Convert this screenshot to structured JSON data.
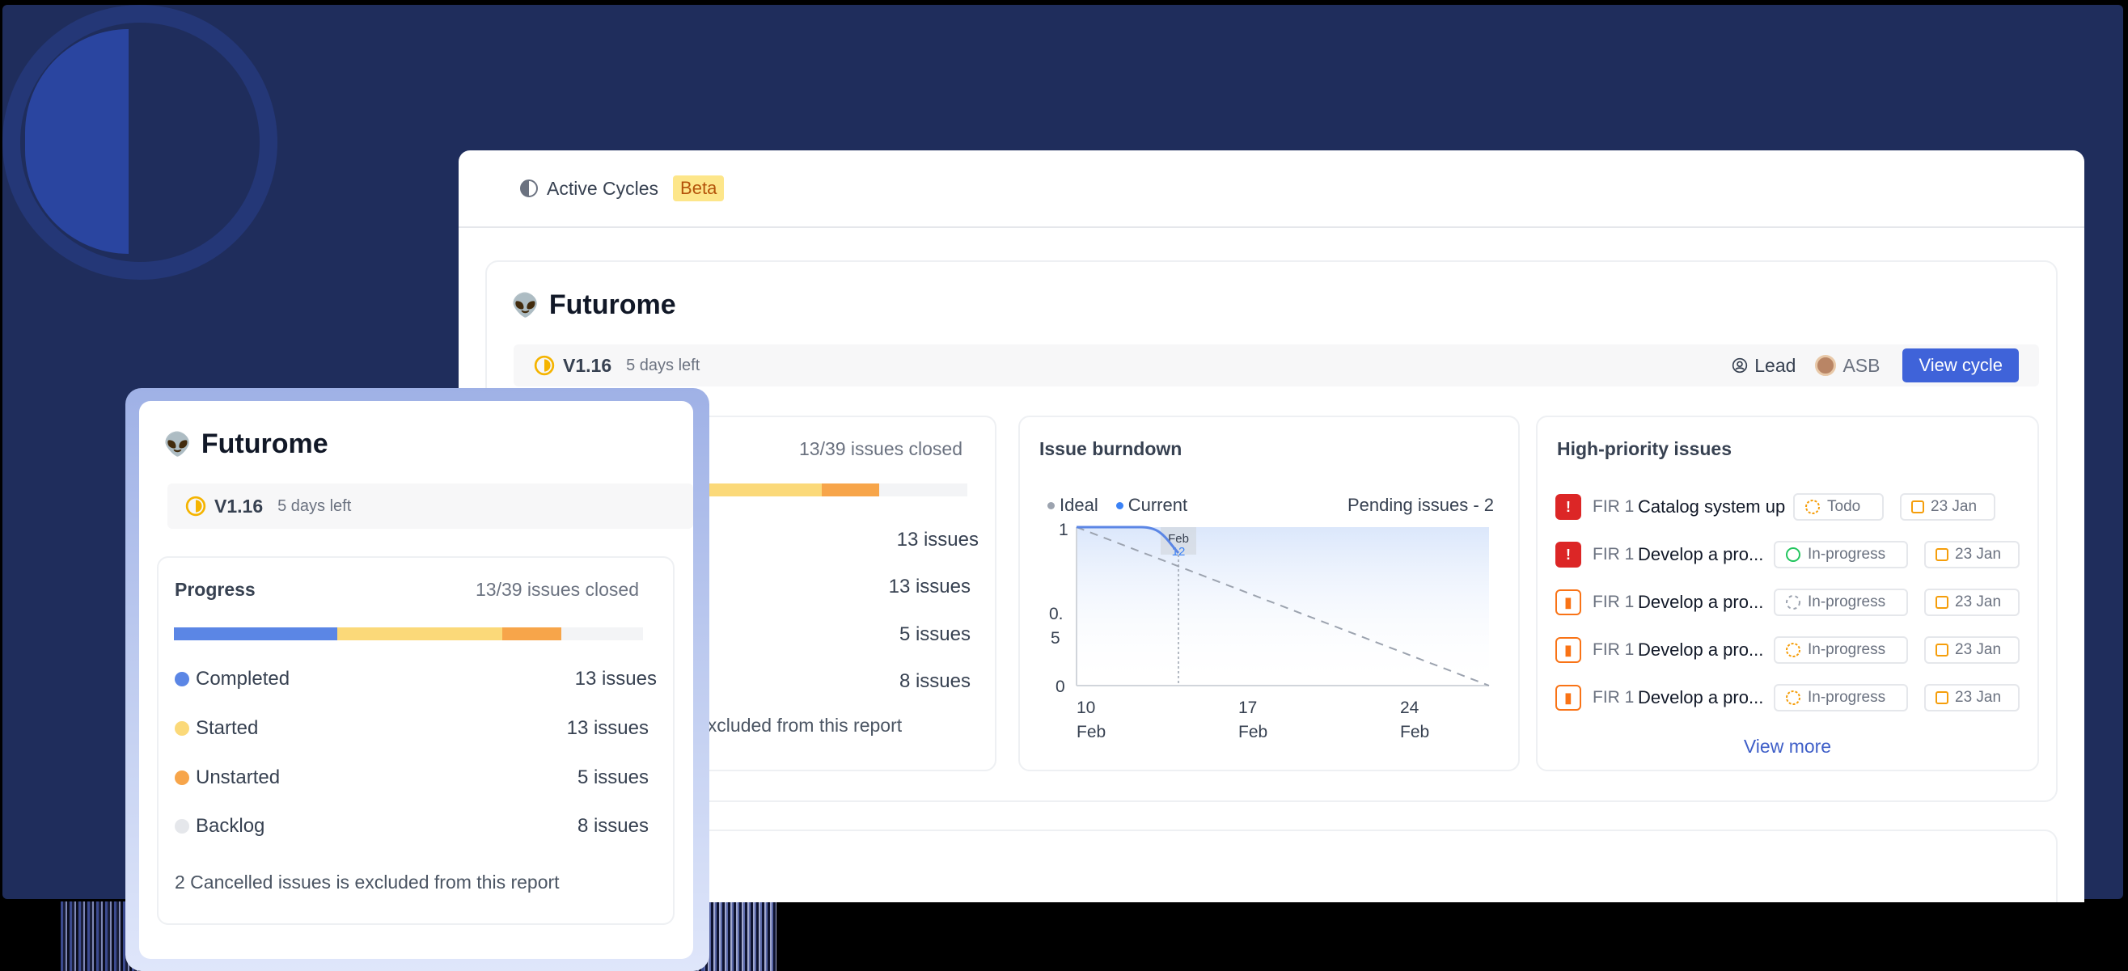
{
  "header": {
    "title": "Active Cycles",
    "badge": "Beta"
  },
  "cycle": {
    "emoji": "👽",
    "name": "Futurome",
    "version": "V1.16",
    "days_left": "5 days left",
    "lead_label": "Lead",
    "lead_name": "ASB",
    "view_cycle": "View cycle"
  },
  "progress": {
    "title": "Progress",
    "closed": "13/39 issues closed",
    "rows": [
      {
        "label": "Completed",
        "count": "13 issues",
        "color": "#5b86e5"
      },
      {
        "label": "Started",
        "count": "13 issues",
        "color": "#fbd979"
      },
      {
        "label": "Unstarted",
        "count": "5 issues",
        "color": "#f7a54a"
      },
      {
        "label": "Backlog",
        "count": "8 issues",
        "color": "#e5e7eb"
      }
    ],
    "excluded_note": "2 Cancelled issues is excluded from this report",
    "excluded_tail": "excluded from this report"
  },
  "burndown": {
    "title": "Issue burndown",
    "legend_ideal": "Ideal",
    "legend_current": "Current",
    "pending": "Pending issues - 2",
    "marker_line1": "Feb",
    "marker_line2": "12",
    "y_ticks": [
      "1",
      "0.",
      "5",
      "0"
    ],
    "x_ticks": [
      {
        "day": "10",
        "month": "Feb"
      },
      {
        "day": "17",
        "month": "Feb"
      },
      {
        "day": "24",
        "month": "Feb"
      }
    ]
  },
  "chart_data": {
    "type": "line",
    "title": "Issue burndown",
    "series": [
      {
        "name": "Ideal",
        "x": [
          "Feb 10",
          "Feb 12",
          "Feb 17",
          "Feb 24",
          "Feb 26"
        ],
        "y": [
          1,
          0.88,
          0.6,
          0.18,
          0
        ]
      },
      {
        "name": "Current",
        "x": [
          "Feb 10",
          "Feb 12",
          "Feb 12.5"
        ],
        "y": [
          1,
          1,
          0.85
        ]
      }
    ],
    "ylim": [
      0,
      1
    ]
  },
  "high_priority": {
    "title": "High-priority issues",
    "view_more": "View more",
    "issues": [
      {
        "priority": "urgent",
        "id": "FIR 1",
        "name": "Catalog system up...",
        "state": "Todo",
        "date": "23 Jan"
      },
      {
        "priority": "urgent",
        "id": "FIR 1",
        "name": "Develop a pro...",
        "state": "In-progress",
        "date": "23 Jan"
      },
      {
        "priority": "high",
        "id": "FIR 1",
        "name": "Develop a pro...",
        "state": "In-progress",
        "date": "23 Jan"
      },
      {
        "priority": "high",
        "id": "FIR 1",
        "name": "Develop a pro...",
        "state": "In-progress",
        "date": "23 Jan"
      },
      {
        "priority": "high",
        "id": "FIR 1",
        "name": "Develop a pro...",
        "state": "In-progress",
        "date": "23 Jan"
      }
    ]
  }
}
